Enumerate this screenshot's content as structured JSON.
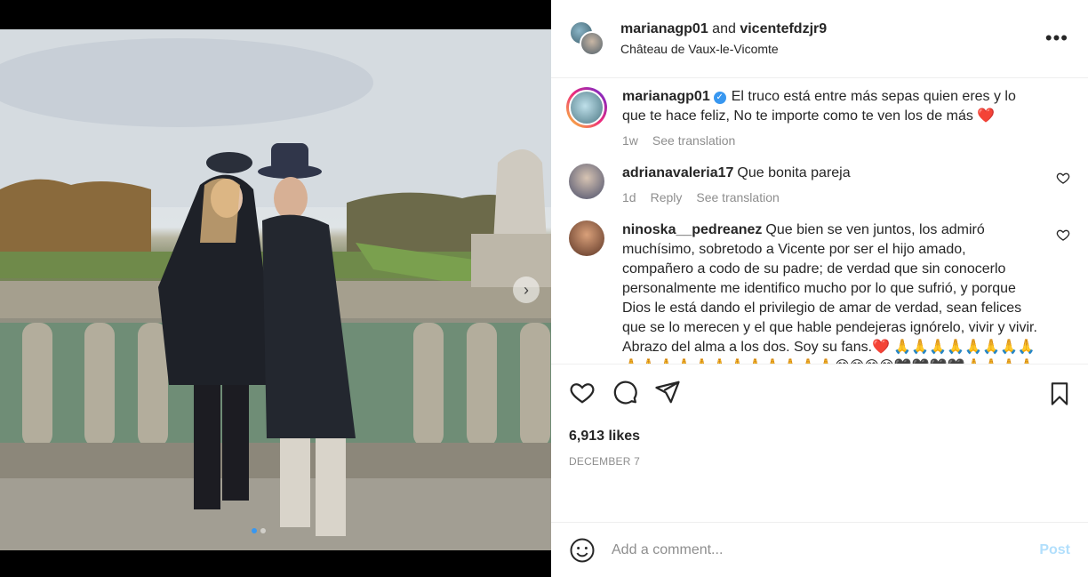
{
  "post": {
    "author": "marianagp01",
    "joiner": "and",
    "collaborator": "vicentefdzjr9",
    "location": "Château de Vaux-le-Vicomte",
    "more_glyph": "•••"
  },
  "comments": [
    {
      "user": "marianagp01",
      "verified": true,
      "text": "El truco está entre más sepas quien eres y lo que te hace feliz, No te importe como te ven los de más ❤️",
      "time": "1w",
      "actions": [
        "See translation"
      ]
    },
    {
      "user": "adrianavaleria17",
      "text": "Que bonita pareja",
      "time": "1d",
      "actions": [
        "Reply",
        "See translation"
      ]
    },
    {
      "user": "ninoska__pedreanez",
      "text": "Que bien se ven juntos, los admiró muchísimo, sobretodo a Vicente por ser el hijo amado, compañero a codo de su padre; de verdad que sin conocerlo personalmente me identifico mucho por lo que sufrió, y porque Dios le está dando el privilegio de amar de verdad, sean felices que se lo merecen y el que hable pendejeras ignórelo, vivir y vivir. Abrazo del alma a los dos. Soy su fans.❤️ 🙏🙏🙏🙏🙏🙏🙏🙏🙏🙏🙏🙏🙏🙏🙏🙏🙏🙏🙏🙏😊😊😊😊🖤🖤🖤🖤🙏🙏🙏🙏🙏🙏🙏🙏🙏"
    }
  ],
  "stats": {
    "likes": "6,913 likes",
    "date": "DECEMBER 7"
  },
  "composer": {
    "placeholder": "Add a comment...",
    "post_label": "Post"
  },
  "icons": [
    "heart-icon",
    "comment-icon",
    "share-icon",
    "bookmark-icon",
    "emoji-icon",
    "more-icon",
    "chevron-right-icon",
    "verified-icon"
  ],
  "colors": {
    "accent": "#3897f0",
    "post_disabled": "#b2dffc",
    "muted": "#8e8e8e"
  }
}
